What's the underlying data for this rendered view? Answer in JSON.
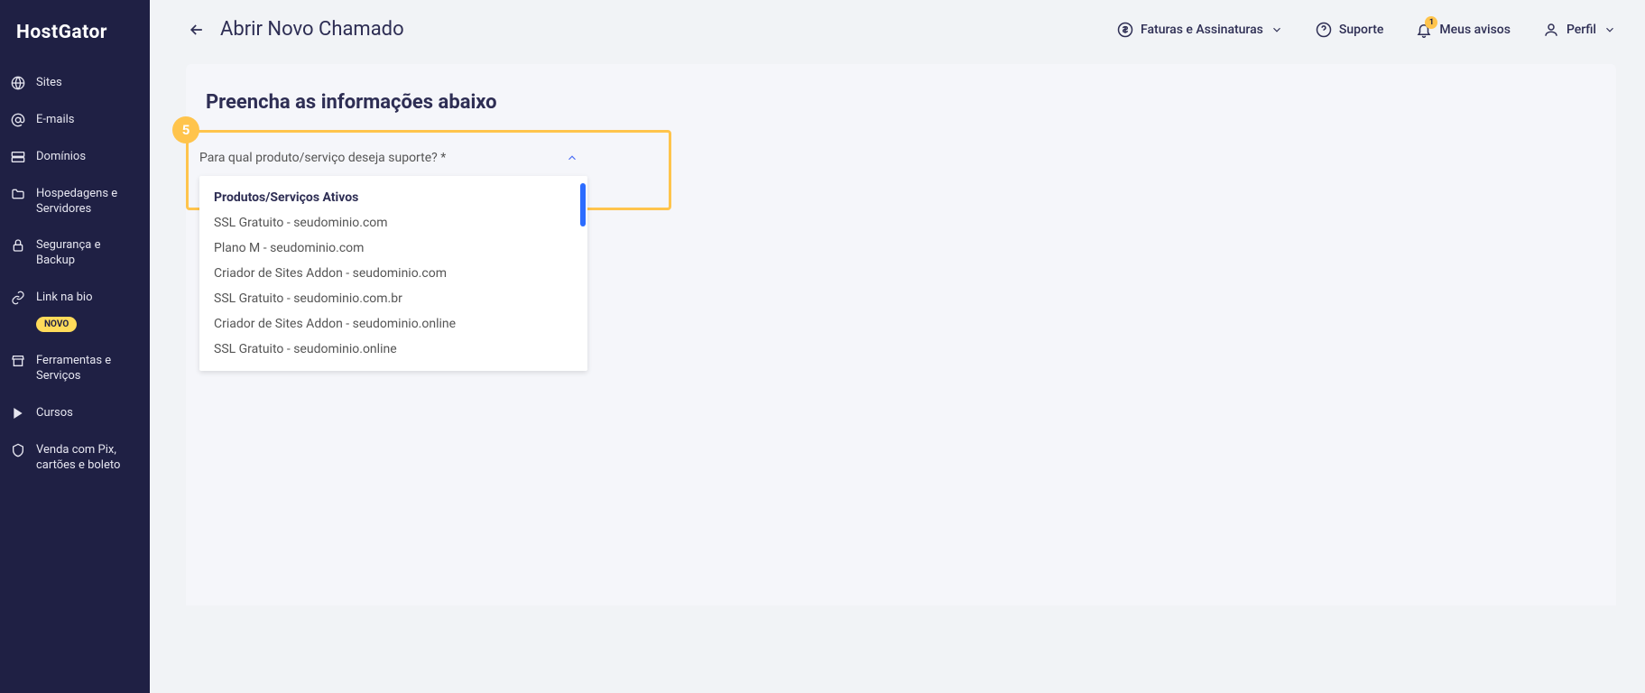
{
  "logo_text": "HostGator",
  "sidebar": {
    "items": [
      {
        "label": "Sites",
        "icon": "globe"
      },
      {
        "label": "E-mails",
        "icon": "at"
      },
      {
        "label": "Domínios",
        "icon": "server"
      },
      {
        "label": "Hospedagens e Servidores",
        "icon": "folder"
      },
      {
        "label": "Segurança e Backup",
        "icon": "lock"
      },
      {
        "label": "Link na bio",
        "icon": "link",
        "badge": "NOVO"
      },
      {
        "label": "Ferramentas e Serviços",
        "icon": "store"
      },
      {
        "label": "Cursos",
        "icon": "play"
      },
      {
        "label": "Venda com Pix, cartões e boleto",
        "icon": "shield"
      }
    ]
  },
  "header": {
    "title": "Abrir Novo Chamado",
    "faturas_label": "Faturas e Assinaturas",
    "suporte_label": "Suporte",
    "avisos_label": "Meus avisos",
    "avisos_count": "1",
    "perfil_label": "Perfil"
  },
  "form": {
    "section_title": "Preencha as informações abaixo",
    "step_number": "5",
    "select_label": "Para qual produto/serviço deseja suporte? *",
    "dropdown_header": "Produtos/Serviços Ativos",
    "options": [
      "SSL Gratuito - seudominio.com",
      "Plano M - seudominio.com",
      "Criador de Sites Addon - seudominio.com",
      "SSL Gratuito - seudominio.com.br",
      "Criador de Sites Addon - seudominio.online",
      "SSL Gratuito - seudominio.online"
    ]
  }
}
